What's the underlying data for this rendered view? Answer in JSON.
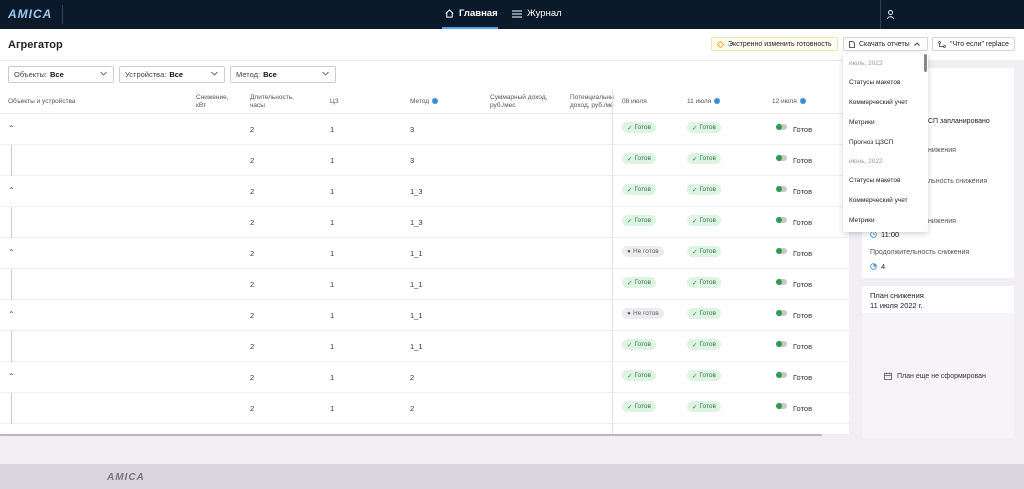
{
  "app": {
    "logo": "AMICA"
  },
  "nav": {
    "home": "Главная",
    "journal": "Журнал"
  },
  "header": {
    "title": "Агрегатор",
    "urgent_button": "Экстренно изменить готовность",
    "download_button": "Скачать отчеты",
    "whatif_button": "\"Что если\" replace"
  },
  "filters": [
    {
      "label": "Объекты:",
      "value": "Все"
    },
    {
      "label": "Устройства:",
      "value": "Все"
    },
    {
      "label": "Метод:",
      "value": "Все"
    }
  ],
  "table": {
    "columns": {
      "objects": "Объекты и устройства",
      "reduction": "Снижение, кВт",
      "duration": "Длительность, часы",
      "cz": "ЦЗ",
      "method": "Метод",
      "income": "Суммарный доход, руб./мес",
      "potential": "Потенциальный доход, руб./ме",
      "d1": "08 июля",
      "d2": "11 июля",
      "d3": "12 июля"
    },
    "rows": [
      {
        "child": false,
        "duration": "2",
        "cz": "1",
        "method": "3",
        "d1": "Готов",
        "d1_ok": true,
        "d2": "Готов",
        "d3": "Готов"
      },
      {
        "child": true,
        "duration": "2",
        "cz": "1",
        "method": "3",
        "d1": "Готов",
        "d1_ok": true,
        "d2": "Готов",
        "d3": "Готов"
      },
      {
        "child": false,
        "duration": "2",
        "cz": "1",
        "method": "1_3",
        "d1": "Готов",
        "d1_ok": true,
        "d2": "Готов",
        "d3": "Готов"
      },
      {
        "child": true,
        "duration": "2",
        "cz": "1",
        "method": "1_3",
        "d1": "Готов",
        "d1_ok": true,
        "d2": "Готов",
        "d3": "Готов"
      },
      {
        "child": false,
        "duration": "2",
        "cz": "1",
        "method": "1_1",
        "d1": "Не готов",
        "d1_ok": false,
        "d2": "Готов",
        "d3": "Готов"
      },
      {
        "child": true,
        "duration": "2",
        "cz": "1",
        "method": "1_1",
        "d1": "Готов",
        "d1_ok": true,
        "d2": "Готов",
        "d3": "Готов"
      },
      {
        "child": false,
        "duration": "2",
        "cz": "1",
        "method": "1_1",
        "d1": "Не готов",
        "d1_ok": false,
        "d2": "Готов",
        "d3": "Готов"
      },
      {
        "child": true,
        "duration": "2",
        "cz": "1",
        "method": "1_1",
        "d1": "Готов",
        "d1_ok": true,
        "d2": "Готов",
        "d3": "Готов"
      },
      {
        "child": false,
        "duration": "2",
        "cz": "1",
        "method": "2",
        "d1": "Готов",
        "d1_ok": true,
        "d2": "Готов",
        "d3": "Готов"
      },
      {
        "child": true,
        "duration": "2",
        "cz": "1",
        "method": "2",
        "d1": "Готов",
        "d1_ok": true,
        "d2": "Готов",
        "d3": "Готов"
      }
    ]
  },
  "side": {
    "planned": "СП запланировано",
    "t1": "нижения",
    "t2": "льность снижения",
    "t3": "нижения",
    "time": "11:00",
    "duration_label": "Продолжительность снижения",
    "duration_value": "4"
  },
  "plan": {
    "title": "План снижения",
    "date": "11 июля 2022 г.",
    "empty": "План еще не сформирован"
  },
  "download_menu": {
    "group1": "июль, 2022",
    "items1": [
      "Статусы макетов",
      "Коммерческий учет",
      "Метрики",
      "Прогноз ЦЗСП"
    ],
    "group2": "июнь, 2022",
    "items2": [
      "Статусы макетов",
      "Коммерческий учет",
      "Метрики"
    ]
  }
}
